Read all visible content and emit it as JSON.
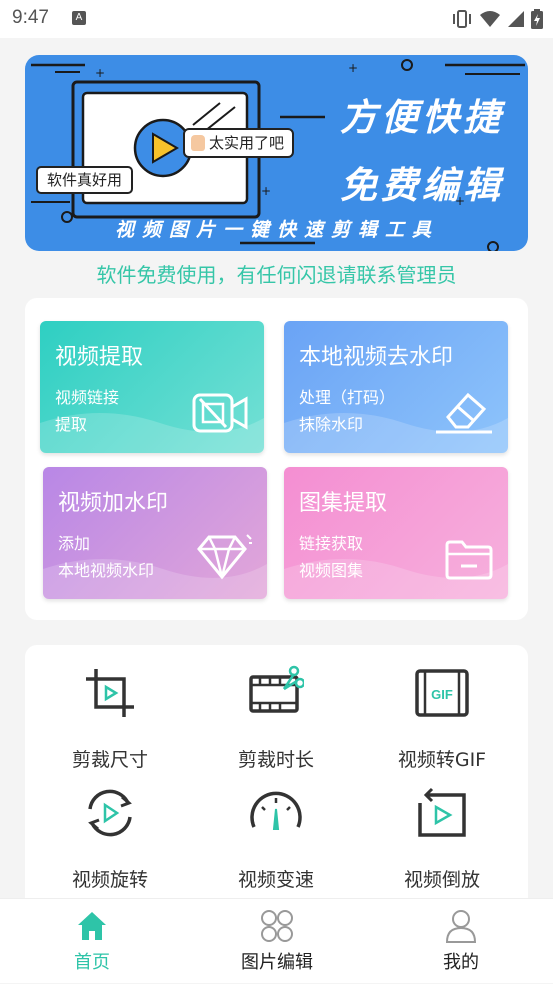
{
  "status": {
    "time": "9:47",
    "app_icon_letter": "A"
  },
  "banner": {
    "title_line1": "方便快捷",
    "title_line2": "免费编辑",
    "subtitle": "视频图片一键快速剪辑工具",
    "bubble_top": "太实用了吧",
    "bubble_left": "软件真好用"
  },
  "notice": "软件免费使用，有任何闪退请联系管理员",
  "features": [
    {
      "title": "视频提取",
      "desc1": "视频链接",
      "desc2": "提取",
      "icon": "video-extract-icon"
    },
    {
      "title": "本地视频去水印",
      "desc1": "处理（打码）",
      "desc2": "抹除水印",
      "icon": "eraser-icon"
    },
    {
      "title": "视频加水印",
      "desc1": "添加",
      "desc2": "本地视频水印",
      "icon": "diamond-icon"
    },
    {
      "title": "图集提取",
      "desc1": "链接获取",
      "desc2": "视频图集",
      "icon": "folder-icon"
    }
  ],
  "tools": [
    {
      "label": "剪裁尺寸",
      "icon": "crop-icon"
    },
    {
      "label": "剪裁时长",
      "icon": "film-scissors-icon"
    },
    {
      "label": "视频转GIF",
      "icon": "gif-icon"
    },
    {
      "label": "视频旋转",
      "icon": "rotate-icon"
    },
    {
      "label": "视频变速",
      "icon": "speedometer-icon"
    },
    {
      "label": "视频倒放",
      "icon": "reverse-play-icon"
    }
  ],
  "tabs": [
    {
      "label": "首页",
      "active": true,
      "icon": "home-icon"
    },
    {
      "label": "图片编辑",
      "active": false,
      "icon": "clover-icon"
    },
    {
      "label": "我的",
      "active": false,
      "icon": "user-icon"
    }
  ],
  "colors": {
    "accent": "#2ec4a8",
    "banner": "#3d8de6"
  }
}
